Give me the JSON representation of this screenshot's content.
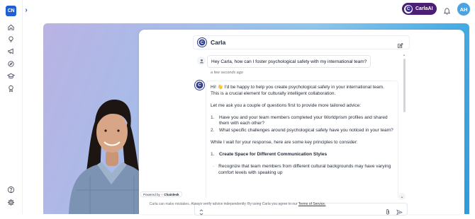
{
  "app": {
    "logo_text": "CN"
  },
  "topbar": {
    "carla_button_label": "CarlaAI",
    "user_initials": "AH"
  },
  "sidebar": {
    "items": [
      {
        "name": "home",
        "icon": "home-icon"
      },
      {
        "name": "insights",
        "icon": "lightbulb-icon"
      },
      {
        "name": "feedback",
        "icon": "megaphone-icon"
      },
      {
        "name": "explore",
        "icon": "compass-icon"
      },
      {
        "name": "learning",
        "icon": "graduation-cap-icon"
      },
      {
        "name": "goals",
        "icon": "award-icon"
      }
    ],
    "bottom_items": [
      {
        "name": "help",
        "icon": "help-icon"
      },
      {
        "name": "settings",
        "icon": "gear-icon"
      }
    ]
  },
  "chat": {
    "title": "Carla",
    "bot_initial": "C",
    "user_message": "Hey Carla, how can I foster psychological safety with my international team?",
    "timestamp": "a few seconds ago",
    "response": {
      "intro": "Hi! 👋 I'd be happy to help you create psychological safety in your international team. This is a crucial element for culturally intelligent collaboration.",
      "ask": "Let me ask you a couple of questions first to provide more tailored advice:",
      "questions": [
        "Have you and your team members completed your Worldprism profiles and shared them with each other?",
        "What specific challenges around psychological safety have you noticed in your team?"
      ],
      "principles_intro": "While I wait for your response, here are some key principles to consider:",
      "principle_1_title": "Create Space for Different Communication Styles",
      "principle_1_bullet": "Recognize that team members from different cultural backgrounds may have varying comfort levels with speaking up"
    },
    "composer_placeholder": "",
    "powered_by_label": "Powered by",
    "powered_by_brand": "Chainlesk",
    "disclaimer_text": "Carla can make mistakes. Always verify advice independently. By using Carla you agree to our",
    "disclaimer_link": "Terms of Service."
  },
  "colors": {
    "accent": "#1d5fd6",
    "carla_pill": "#4a1f74",
    "avatar": "#4ba3e3",
    "bot": "#2f3e8c"
  }
}
